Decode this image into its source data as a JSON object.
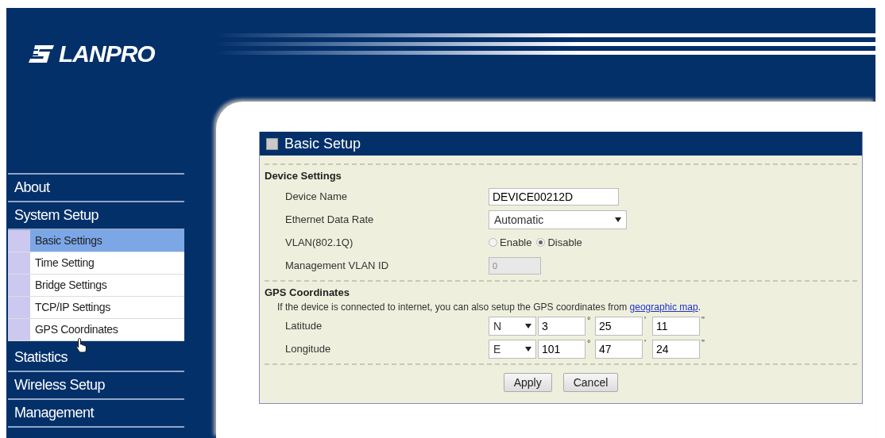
{
  "header": {
    "logo": "LANPRO"
  },
  "sidebar": {
    "items": [
      {
        "label": "About"
      },
      {
        "label": "System Setup",
        "children": [
          {
            "label": "Basic Settings",
            "selected": true
          },
          {
            "label": "Time Setting",
            "selected": false
          },
          {
            "label": "Bridge Settings",
            "selected": false
          },
          {
            "label": "TCP/IP Settings",
            "selected": false
          },
          {
            "label": "GPS Coordinates",
            "selected": false
          }
        ]
      },
      {
        "label": "Statistics"
      },
      {
        "label": "Wireless Setup"
      },
      {
        "label": "Management"
      }
    ]
  },
  "panel": {
    "title": "Basic Setup",
    "device_settings": {
      "heading": "Device Settings",
      "rows": [
        {
          "kind": "text",
          "label": "Device Name",
          "value": "DEVICE00212D",
          "disabled": false
        },
        {
          "kind": "select",
          "label": "Ethernet Data Rate",
          "value": "Automatic"
        },
        {
          "kind": "radio",
          "label": "VLAN(802.1Q)",
          "options": [
            {
              "label": "Enable",
              "selected": false
            },
            {
              "label": "Disable",
              "selected": true
            }
          ]
        },
        {
          "kind": "text",
          "label": "Management VLAN ID",
          "value": "0",
          "disabled": true
        }
      ]
    },
    "gps": {
      "heading": "GPS Coordinates",
      "note": "If the device is connected to internet, you can also setup the GPS coordinates from",
      "link": "geographic map",
      "note_end": ".",
      "rows": [
        {
          "label": "Latitude",
          "direction": "N",
          "degrees": "3",
          "minutes": "25",
          "seconds": "11"
        },
        {
          "label": "Longitude",
          "direction": "E",
          "degrees": "101",
          "minutes": "47",
          "seconds": "24"
        }
      ],
      "degree_mark": "°",
      "minute_mark": "'",
      "second_mark": "\""
    },
    "buttons": [
      "Apply",
      "Cancel"
    ]
  }
}
